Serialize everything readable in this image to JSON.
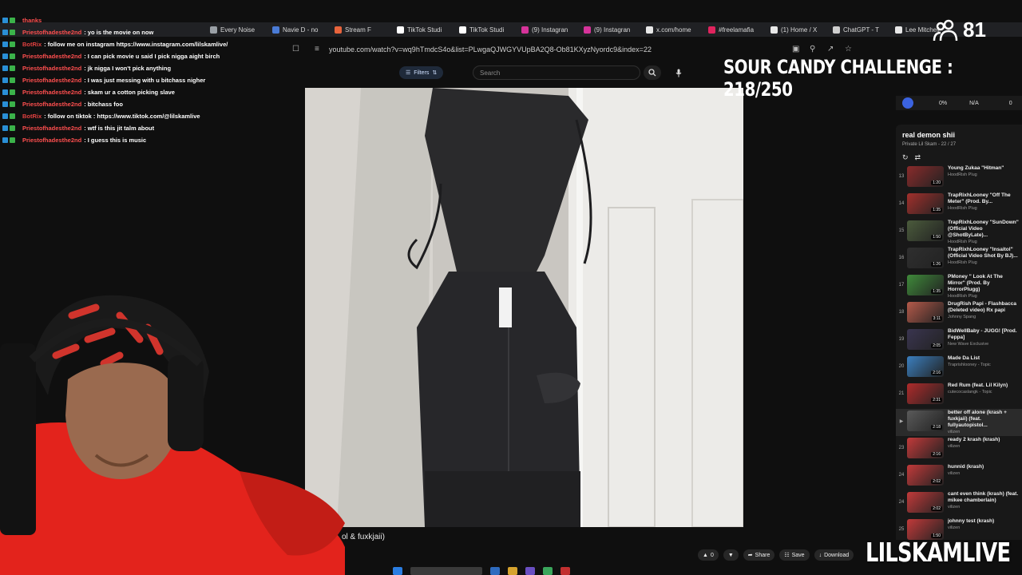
{
  "chat": [
    {
      "user": "thanks",
      "msg": "",
      "bot": false
    },
    {
      "user": "Priestofhadesthe2nd",
      "msg": ": yo is the movie on now",
      "bot": false
    },
    {
      "user": "BotRix",
      "msg": ": follow me on instagram https://www.instagram.com/lilskamlive/",
      "bot": true
    },
    {
      "user": "Priestofhadesthe2nd",
      "msg": ": I can pick movie u said I pick nigga aight birch",
      "bot": false
    },
    {
      "user": "Priestofhadesthe2nd",
      "msg": ": jk nigga I won't pick anything",
      "bot": false
    },
    {
      "user": "Priestofhadesthe2nd",
      "msg": ": I was just messing with u bitchass nigher",
      "bot": false
    },
    {
      "user": "Priestofhadesthe2nd",
      "msg": ": skam ur a cotton picking slave",
      "bot": false
    },
    {
      "user": "Priestofhadesthe2nd",
      "msg": ": bitchass foo",
      "bot": false
    },
    {
      "user": "BotRix",
      "msg": ": follow on tiktok : https://www.tiktok.com/@lilskamlive",
      "bot": true
    },
    {
      "user": "Priestofhadesthe2nd",
      "msg": ": wtf is this jit talm about",
      "bot": false
    },
    {
      "user": "Priestofhadesthe2nd",
      "msg": ": I guess this is music",
      "bot": false
    }
  ],
  "tabs": [
    {
      "label": "Every Noise",
      "color": "#9aa0a6"
    },
    {
      "label": "Navie D - no",
      "color": "#4a7bd6"
    },
    {
      "label": "Stream F",
      "color": "#e8643c"
    },
    {
      "label": "TikTok Studi",
      "color": "#ffffff"
    },
    {
      "label": "TikTok Studi",
      "color": "#ffffff"
    },
    {
      "label": "(9) Instagran",
      "color": "#d6339a"
    },
    {
      "label": "(9) Instagran",
      "color": "#d6339a"
    },
    {
      "label": "x.com/home",
      "color": "#e8e8e8"
    },
    {
      "label": "#freelamafia",
      "color": "#e0245e"
    },
    {
      "label": "(1) Home / X",
      "color": "#e8e8e8"
    },
    {
      "label": "ChatGPT - T",
      "color": "#cfcfcf"
    },
    {
      "label": "Lee Mitchell",
      "color": "#e8e8e8"
    }
  ],
  "address": {
    "url": "youtube.com/watch?v=wq9hTmdcS4o&list=PLwgaQJWGYVUpBA2Q8-Ob81KXyzNyordc9&index=22"
  },
  "search": {
    "filters_label": "Filters",
    "placeholder": "Search"
  },
  "overlay": {
    "viewers": "81",
    "challenge": "SOUR CANDY CHALLENGE : 218/250",
    "brand": "LILSKAMLIVE"
  },
  "extension": {
    "a": "0%",
    "b": "N/A",
    "c": "0"
  },
  "playlist": {
    "title": "real demon shii",
    "subtitle": "Private  Lil Skam - 22 / 27",
    "items": [
      {
        "idx": "13",
        "title": "Young Zukaa \"Hitman\"",
        "channel": "HoodRish Plug",
        "dur": "1:20",
        "color": "#8a2b2b"
      },
      {
        "idx": "14",
        "title": "TrapRixhLooney \"Off The Meter\" (Prod. By...",
        "channel": "HoodRish Plug",
        "dur": "1:35",
        "color": "#a3302c"
      },
      {
        "idx": "15",
        "title": "TrapRixhLooney \"SunDown\" (Official Video @ShotByLate)...",
        "channel": "HoodRish Plug",
        "dur": "1:50",
        "color": "#4b5b3c"
      },
      {
        "idx": "16",
        "title": "TrapRixhLooney \"Insaitol\" (Official Video Shot By BJ)...",
        "channel": "HoodRish Plug",
        "dur": "1:26",
        "color": "#2f2f2f"
      },
      {
        "idx": "17",
        "title": "PMoney \" Look At The Mirror\" (Prod. By HorrorPlugg)",
        "channel": "HoodRish Plug",
        "dur": "1:35",
        "color": "#3f8a3a"
      },
      {
        "idx": "18",
        "title": "DrugRish Papi - Flashbacca (Deleted video) Rx papi",
        "channel": "Johnny Spang",
        "dur": "3:11",
        "color": "#b55a4a"
      },
      {
        "idx": "19",
        "title": "BidWellBaby - JUGG! [Prod. Feppa]",
        "channel": "New Wave Exclusive",
        "dur": "2:05",
        "color": "#3a3550"
      },
      {
        "idx": "20",
        "title": "Made Da List",
        "channel": "Traprishlooney - Topic",
        "dur": "2:16",
        "color": "#3b7fbf"
      },
      {
        "idx": "21",
        "title": "Red Rum (feat. Lil Kilyn)",
        "channel": "cutecocaslangk - Topic",
        "dur": "2:31",
        "color": "#b02b2b"
      },
      {
        "idx": "▶",
        "title": "better off alone (krash + fuxkjaii) (feat. fullyautopistol...",
        "channel": "vilizen",
        "dur": "2:18",
        "color": "#5a5a5a"
      },
      {
        "idx": "23",
        "title": "ready 2 krash (krash)",
        "channel": "vilizen",
        "dur": "2:16",
        "color": "#c23a3a"
      },
      {
        "idx": "24",
        "title": "hunnid (krash)",
        "channel": "vilizen",
        "dur": "2:02",
        "color": "#c23a3a"
      },
      {
        "idx": "24",
        "title": "cant even think (krash) (feat. mikee chamberlain)",
        "channel": "vilizen",
        "dur": "2:02",
        "color": "#c23a3a"
      },
      {
        "idx": "25",
        "title": "johnny test (krash)",
        "channel": "vilizen",
        "dur": "1:50",
        "color": "#c23a3a"
      }
    ]
  },
  "caption": "ol & fuxkjaii)",
  "actions": {
    "like": "0",
    "share": "Share",
    "save": "Save",
    "download": "Download"
  }
}
